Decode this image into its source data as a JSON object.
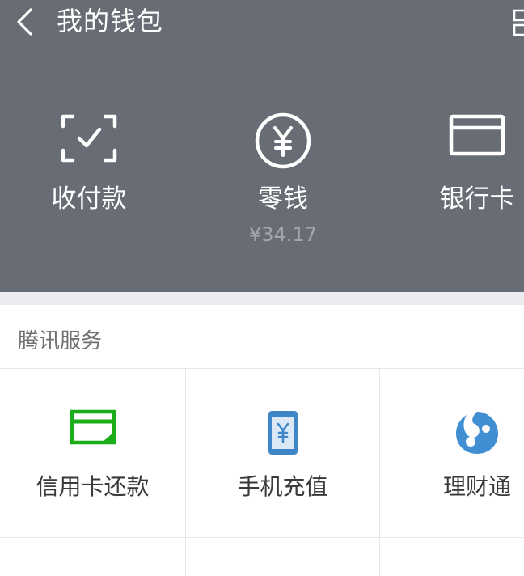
{
  "header": {
    "title": "我的钱包",
    "back_icon": "chevron-left-icon",
    "more_icon": "grid-icon"
  },
  "wallet": {
    "items": [
      {
        "label": "收付款",
        "icon": "scan-check-icon"
      },
      {
        "label": "零钱",
        "icon": "yuan-circle-icon",
        "balance": "¥34.17"
      },
      {
        "label": "银行卡",
        "icon": "card-icon"
      }
    ]
  },
  "services": {
    "title": "腾讯服务",
    "items": [
      {
        "label": "信用卡还款",
        "icon": "credit-card-repay-icon",
        "color": "#1aad19"
      },
      {
        "label": "手机充值",
        "icon": "phone-recharge-icon",
        "color": "#3f86c9"
      },
      {
        "label": "理财通",
        "icon": "licaitong-icon",
        "color": "#3f8fd2"
      }
    ]
  },
  "colors": {
    "header_bg": "#686d75",
    "page_bg": "#ffffff",
    "divider": "#e6e6e6"
  }
}
